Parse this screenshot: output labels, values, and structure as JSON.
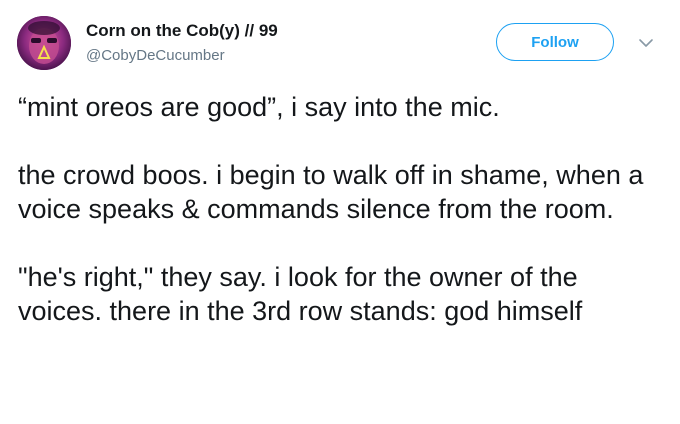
{
  "tweet": {
    "author": {
      "display_name": "Corn on the Cob(y) // 99",
      "handle": "@CobyDeCucumber"
    },
    "follow_label": "Follow",
    "paragraphs": [
      "“mint oreos are good”, i say into the mic.",
      "the crowd boos. i begin to walk off in shame, when a voice speaks & commands silence from the room.",
      "\"he's right,\" they say. i look for the owner of the voices. there in the 3rd row stands: god himself"
    ]
  },
  "colors": {
    "accent": "#1da1f2",
    "text": "#14171a",
    "secondary_text": "#657786",
    "avatar_bg": "#6b1f6e"
  },
  "icons": {
    "avatar": "avatar-image",
    "caret": "chevron-down-icon"
  }
}
